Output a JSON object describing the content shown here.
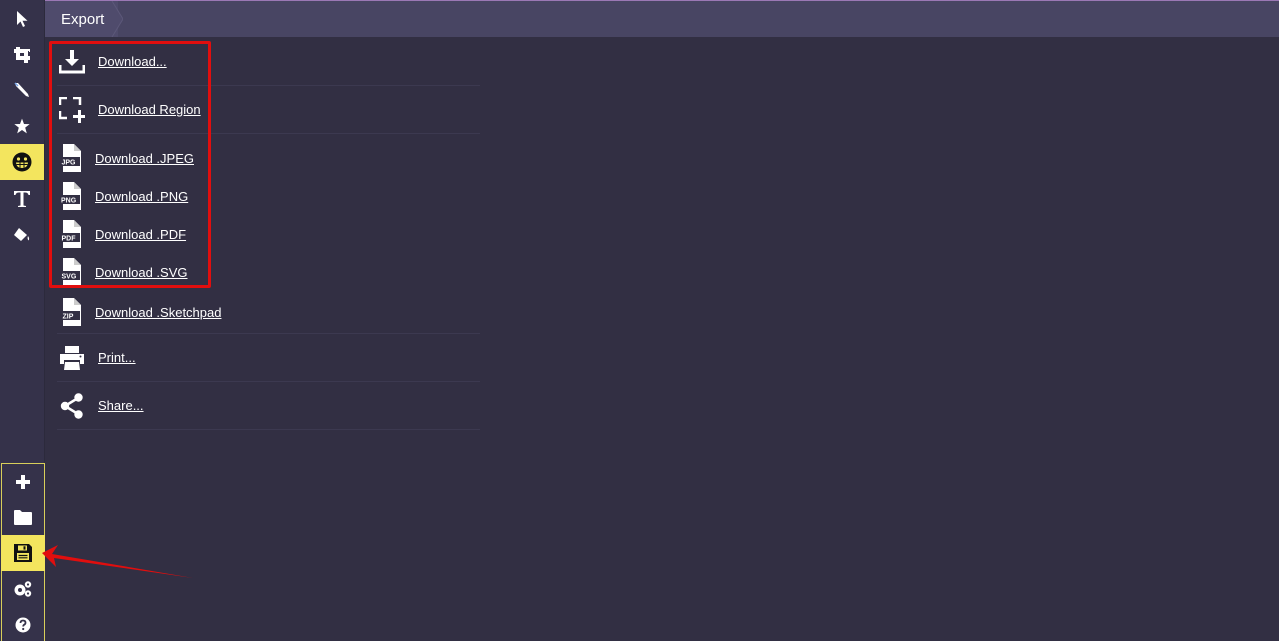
{
  "header": {
    "breadcrumb": "Export"
  },
  "sidebar": {
    "top_tools": [
      {
        "name": "select",
        "icon": "cursor-arrow-icon",
        "active": false
      },
      {
        "name": "crop",
        "icon": "crop-icon",
        "active": false
      },
      {
        "name": "pen",
        "icon": "pen-icon",
        "active": false
      },
      {
        "name": "shapes",
        "icon": "star-icon",
        "active": false
      },
      {
        "name": "emoji",
        "icon": "grin-emoji-icon",
        "active": true
      },
      {
        "name": "text",
        "icon": "text-t-icon",
        "active": false
      },
      {
        "name": "fill",
        "icon": "paint-bucket-icon",
        "active": false
      }
    ],
    "bottom_tools": [
      {
        "name": "new",
        "icon": "plus-icon",
        "active": false
      },
      {
        "name": "open",
        "icon": "folder-icon",
        "active": false
      },
      {
        "name": "save",
        "icon": "floppy-disk-icon",
        "active": true
      },
      {
        "name": "settings",
        "icon": "gears-icon",
        "active": false
      },
      {
        "name": "help",
        "icon": "question-circle-icon",
        "active": false
      }
    ],
    "active_color": "#f3e55e"
  },
  "export_menu": {
    "items": [
      {
        "label": "Download...",
        "icon": "download-icon"
      },
      {
        "label": "Download Region",
        "icon": "region-select-icon"
      },
      {
        "label": "Download .JPEG",
        "icon": "file-jpg-icon",
        "badge": "JPG"
      },
      {
        "label": "Download .PNG",
        "icon": "file-png-icon",
        "badge": "PNG"
      },
      {
        "label": "Download .PDF",
        "icon": "file-pdf-icon",
        "badge": "PDF"
      },
      {
        "label": "Download .SVG",
        "icon": "file-svg-icon",
        "badge": "SVG"
      },
      {
        "label": "Download .Sketchpad",
        "icon": "file-zip-icon",
        "badge": "ZIP"
      },
      {
        "label": "Print...",
        "icon": "printer-icon"
      },
      {
        "label": "Share...",
        "icon": "share-icon"
      }
    ]
  },
  "annotations": {
    "highlight_color": "#e10e0e",
    "highlight_box_target": "download-options",
    "arrow_target": "save-tool"
  }
}
